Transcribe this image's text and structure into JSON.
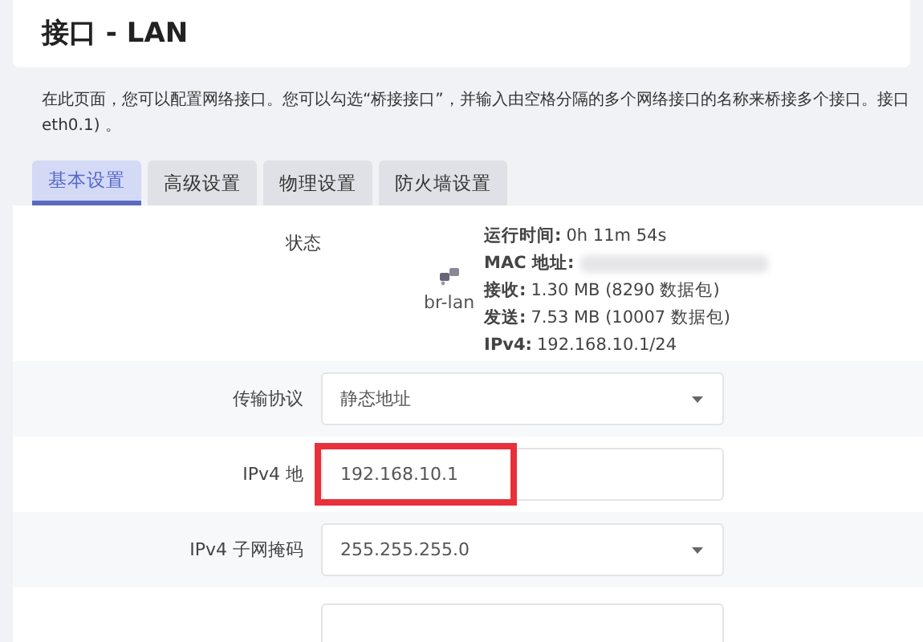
{
  "header": {
    "title": "接口 - LAN"
  },
  "description": {
    "lines": [
      "在此页面，您可以配置网络接口。您可以勾选“桥接接口”，并输入由空格分隔的多个网络接口的名称来桥接多个接口。接口",
      "eth0.1) 。"
    ]
  },
  "tabs": [
    {
      "label": "基本设置",
      "selected": true
    },
    {
      "label": "高级设置",
      "selected": false
    },
    {
      "label": "物理设置",
      "selected": false
    },
    {
      "label": "防火墙设置",
      "selected": false
    }
  ],
  "status": {
    "label": "状态",
    "device": "br-lan",
    "lines": [
      {
        "key": "运行时间:",
        "value": "0h 11m 54s",
        "redacted": false
      },
      {
        "key": "MAC 地址:",
        "redacted": true
      },
      {
        "key": "接收:",
        "value": "1.30 MB (8290 数据包)",
        "redacted": false
      },
      {
        "key": "发送:",
        "value": "7.53 MB (10007 数据包)",
        "redacted": false
      },
      {
        "key": "IPv4:",
        "value": "192.168.10.1/24",
        "redacted": false
      }
    ]
  },
  "fields": [
    {
      "label": "传输协议",
      "kind": "select",
      "value": "静态地址",
      "highlighted": false
    },
    {
      "label": "IPv4 地",
      "kind": "text",
      "value": "192.168.10.1",
      "highlighted": true
    },
    {
      "label": "IPv4 子网掩码",
      "kind": "select",
      "value": "255.255.255.0",
      "highlighted": false
    },
    {
      "kind": "cut"
    }
  ]
}
